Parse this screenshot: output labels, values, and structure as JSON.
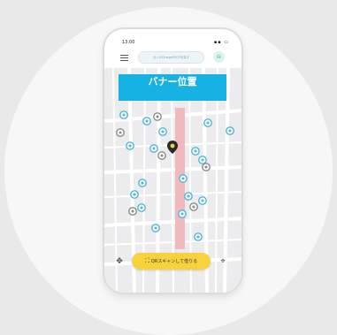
{
  "status_bar": {
    "time": "13:00",
    "icons": "▪▪ ▭"
  },
  "header": {
    "menu_icon": "hamburger-menu-icon",
    "search_placeholder": "近くのChargeSPOTを探す",
    "bell_icon": "bell-icon",
    "bell_glyph": "⍾"
  },
  "banner": {
    "label": "バナー位置",
    "color": "#15b2e3"
  },
  "map": {
    "road_color": "#ffffff",
    "highlight_color": "#f0b9be",
    "pin_blue": "#4fb6d6",
    "pin_gray": "#8a8a8a",
    "current_location_icon": "current-location-icon"
  },
  "bottom_bar": {
    "recenter_icon": "compass-icon",
    "recenter_glyph": "✥",
    "qr_icon": "qr-scan-icon",
    "qr_glyph": "⛶",
    "qr_label": "QRスキャンして借りる",
    "locate_icon": "crosshair-icon",
    "locate_glyph": "⌖",
    "qr_color": "#f6d23d"
  }
}
